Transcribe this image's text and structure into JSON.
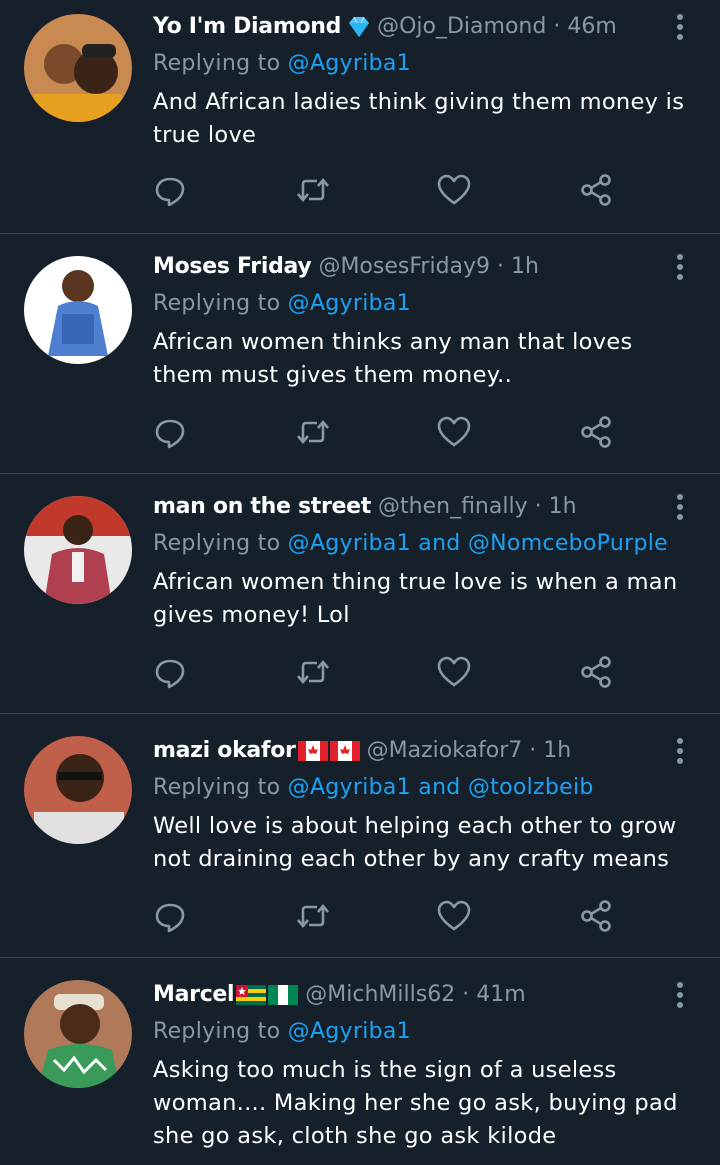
{
  "tweets": [
    {
      "name": "Yo I'm Diamond",
      "handle": "@Ojo_Diamond",
      "time": "46m",
      "reply_prefix": "Replying to",
      "mentions": [
        "@Agyriba1"
      ],
      "text": "And African ladies think giving them money is true love",
      "name_emoji": "gem-icon"
    },
    {
      "name": "Moses Friday",
      "handle": "@MosesFriday9",
      "time": "1h",
      "reply_prefix": "Replying to",
      "mentions": [
        "@Agyriba1"
      ],
      "text": "African women thinks any man that loves them must gives them money.."
    },
    {
      "name": "man on the street",
      "handle": "@then_finally",
      "time": "1h",
      "reply_prefix": "Replying to",
      "mentions": [
        "@Agyriba1",
        "@NomceboPurple"
      ],
      "joiner": "and",
      "text": "African women thing true love is when a man gives money! Lol"
    },
    {
      "name": "mazi okafor",
      "handle": "@Maziokafor7",
      "time": "1h",
      "reply_prefix": "Replying to",
      "mentions": [
        "@Agyriba1",
        "@toolzbeib"
      ],
      "joiner": "and",
      "text": "Well love is about helping each other to grow not draining each other by any crafty means",
      "name_flags": [
        "canada-flag-icon",
        "canada-flag-icon"
      ]
    },
    {
      "name": "Marcel",
      "handle": "@MichMills62",
      "time": "41m",
      "reply_prefix": "Replying to",
      "mentions": [
        "@Agyriba1"
      ],
      "text": "Asking too much is the sign of a useless woman.... Making her she go ask, buying pad she go ask, cloth she go ask kilode",
      "name_flags": [
        "togo-flag-icon",
        "nigeria-flag-icon"
      ]
    }
  ],
  "separator": "·",
  "colors": {
    "background": "#15202b",
    "divider": "#38444d",
    "muted": "#8899a6",
    "accent": "#1da1f2"
  },
  "icons": [
    "reply-icon",
    "retweet-icon",
    "like-icon",
    "share-icon",
    "more-icon"
  ]
}
